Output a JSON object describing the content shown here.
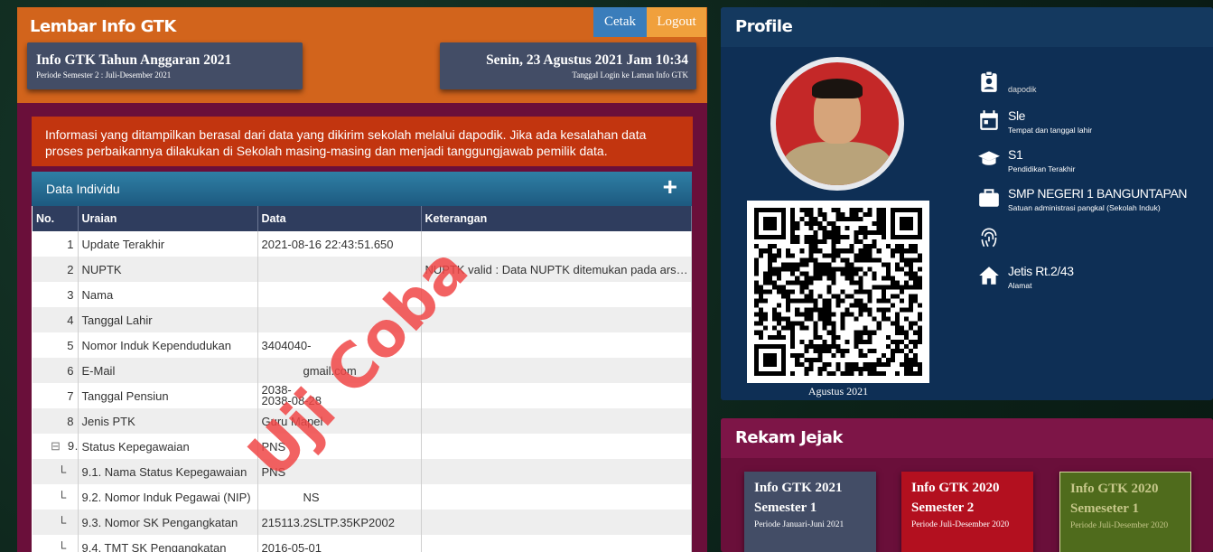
{
  "left": {
    "title": "Lembar Info GTK",
    "btn_cetak": "Cetak",
    "btn_logout": "Logout",
    "info_left_main": "Info GTK Tahun Anggaran 2021",
    "info_left_sub": "Periode Semester 2 : Juli-Desember 2021",
    "info_right_main": "Senin, 23 Agustus 2021 Jam 10:34",
    "info_right_sub": "Tanggal Login ke Laman Info GTK",
    "alert": "Informasi yang ditampilkan berasal dari data yang dikirim sekolah melalui dapodik. Jika ada kesalahan data proses perbaikannya dilakukan di Sekolah masing-masing dan menjadi tanggungjawab pemilik data.",
    "panel_title": "Data Individu",
    "plus": "+",
    "headers": {
      "no": "No.",
      "uraian": "Uraian",
      "data": "Data",
      "ket": "Keterangan"
    },
    "rows": [
      {
        "no": "1",
        "uraian": "Update Terakhir",
        "data": "2021-08-16 22:43:51.650",
        "ket": ""
      },
      {
        "no": "2",
        "uraian": "NUPTK",
        "data": "",
        "ket": "NUPTK valid : Data NUPTK ditemukan pada arsip NUPTK"
      },
      {
        "no": "3",
        "uraian": "Nama",
        "data": "",
        "ket": ""
      },
      {
        "no": "4",
        "uraian": "Tanggal Lahir",
        "data": "",
        "ket": ""
      },
      {
        "no": "5",
        "uraian": "Nomor Induk Kependudukan",
        "data": "3404040-",
        "ket": ""
      },
      {
        "no": "6",
        "uraian": "E-Mail",
        "data": "gmail.com",
        "ket": ""
      },
      {
        "no": "7",
        "uraian": "Tanggal Pensiun",
        "data": "2038-",
        "data2": "2038-08-28",
        "ket": ""
      },
      {
        "no": "8",
        "uraian": "Jenis PTK",
        "data": "Guru Mapel",
        "ket": ""
      },
      {
        "no": "9",
        "uraian": "Status Kepegawaian",
        "data": "PNS",
        "ket": ""
      },
      {
        "no": "",
        "uraian": "9.1. Nama Status Kepegawaian",
        "data": "PNS",
        "ket": ""
      },
      {
        "no": "",
        "uraian": "9.2. Nomor Induk Pegawai (NIP)",
        "data": "NS",
        "ket": ""
      },
      {
        "no": "",
        "uraian": "9.3. Nomor SK Pengangkatan",
        "data": "215113.2SLTP.35KP2002",
        "ket": ""
      },
      {
        "no": "",
        "uraian": "9.4. TMT SK Pengangkatan",
        "data": "2016-05-01",
        "ket": ""
      }
    ],
    "collapse_icon": "⊟",
    "tree_glyph": "└",
    "watermark": "Uji Coba"
  },
  "profile": {
    "title": "Profile",
    "qr_caption": "Agustus 2021",
    "items": [
      {
        "icon": "id-badge-icon",
        "main": "",
        "sub": "dapodik"
      },
      {
        "icon": "calendar-icon",
        "main": "Sle",
        "sub": "Tempat dan tanggal lahir"
      },
      {
        "icon": "graduation-cap-icon",
        "main": "S1",
        "sub": "Pendidikan Terakhir"
      },
      {
        "icon": "briefcase-icon",
        "main": "SMP NEGERI 1 BANGUNTAPAN",
        "sub": "Satuan administrasi pangkal (Sekolah Induk)"
      },
      {
        "icon": "fingerprint-icon",
        "main": "",
        "sub": ""
      },
      {
        "icon": "home-icon",
        "main": "Jetis Rt.2/43",
        "sub": "Alamat"
      }
    ]
  },
  "rekam": {
    "title": "Rekam Jejak",
    "cards": [
      {
        "line1": "Info GTK 2021",
        "line2": "Semester 1",
        "line3": "Periode Januari-Juni 2021"
      },
      {
        "line1": "Info GTK 2020",
        "line2": "Semester 2",
        "line3": "Periode Juli-Desember 2020"
      },
      {
        "line1": "Info GTK 2020",
        "line2": "Semeseter 1",
        "line3": "Periode Juli-Desember 2020"
      }
    ]
  }
}
